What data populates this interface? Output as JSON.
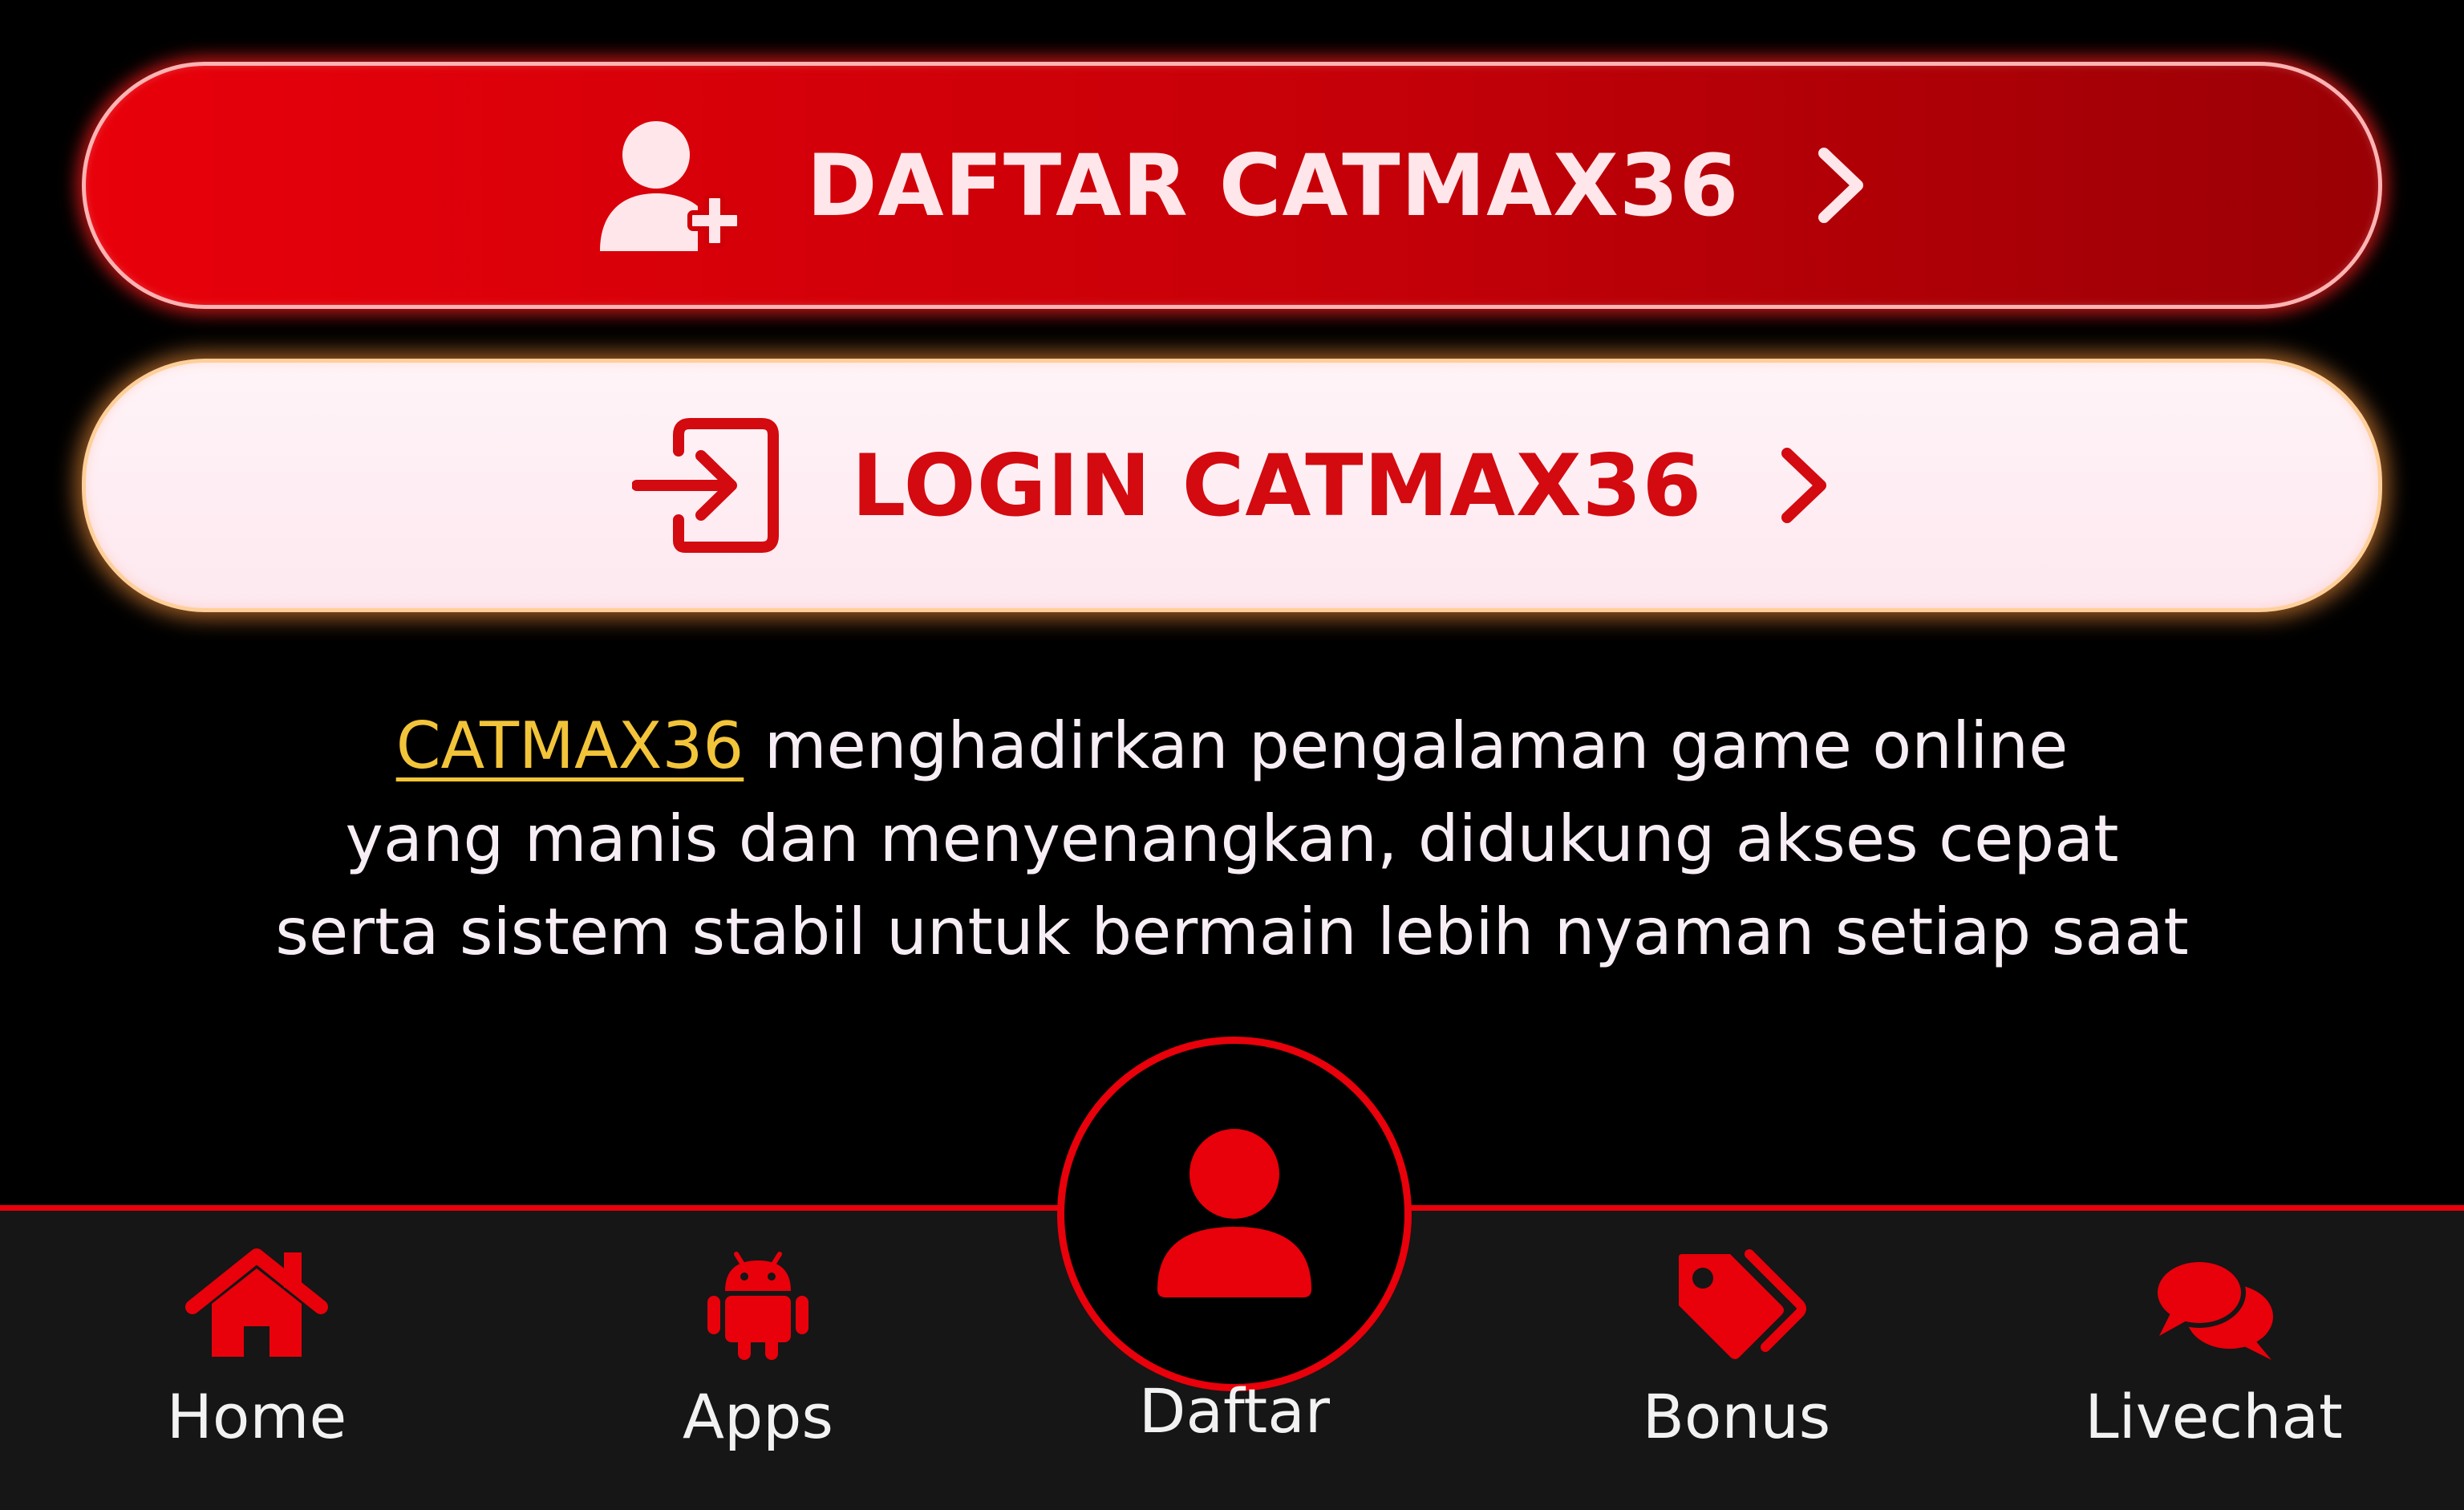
{
  "colors": {
    "brand_red": "#e8000a",
    "brand_gold": "#f2c43a",
    "login_bg": "#fde8ef",
    "nav_bg": "#161616"
  },
  "cta": {
    "register": {
      "label": "DAFTAR CATMAX36",
      "icon": "user-plus-icon",
      "chevron": "chevron-right-icon"
    },
    "login": {
      "label": "LOGIN CATMAX36",
      "icon": "sign-in-icon",
      "chevron": "chevron-right-icon"
    }
  },
  "intro": {
    "brand_link": "CATMAX36",
    "line1_rest": " menghadirkan pengalaman game online",
    "line2": "yang manis dan menyenangkan, didukung akses cepat",
    "line3": "serta sistem stabil untuk bermain lebih nyaman setiap saat"
  },
  "bottom_nav": {
    "active": "Daftar",
    "items": [
      {
        "label": "Home",
        "icon": "home-icon"
      },
      {
        "label": "Apps",
        "icon": "android-icon"
      },
      {
        "label": "Daftar",
        "icon": "user-icon"
      },
      {
        "label": "Bonus",
        "icon": "tags-icon"
      },
      {
        "label": "Livechat",
        "icon": "chat-bubbles-icon"
      }
    ]
  }
}
